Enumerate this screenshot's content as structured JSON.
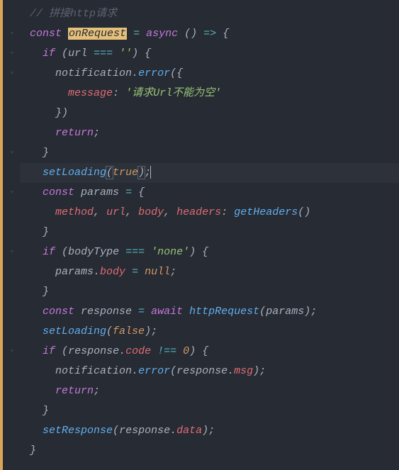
{
  "code": {
    "l1": {
      "comment": "// 拼接http请求"
    },
    "l2": {
      "kw1": "const",
      "name": "onRequest",
      "op": "=",
      "kw2": "async",
      "parens": "()",
      "arrow": "=>",
      "brace": "{"
    },
    "l3": {
      "kw": "if",
      "open": "(",
      "var": "url",
      "op": "===",
      "str": "''",
      "close": ")",
      "brace": "{"
    },
    "l4": {
      "obj": "notification",
      "dot": ".",
      "method": "error",
      "open": "(",
      "brace": "{"
    },
    "l5": {
      "prop": "message",
      "colon": ":",
      "str": "'请求Url不能为空'"
    },
    "l6": {
      "brace": "}",
      "close": ")"
    },
    "l7": {
      "kw": "return",
      "semi": ";"
    },
    "l8": {
      "brace": "}"
    },
    "l9": {
      "fn": "setLoading",
      "open": "(",
      "val": "true",
      "close": ")",
      "semi": ";"
    },
    "l10": {
      "kw": "const",
      "var": "params",
      "op": "=",
      "brace": "{"
    },
    "l11": {
      "p1": "method",
      "c1": ",",
      "p2": "url",
      "c2": ",",
      "p3": "body",
      "c3": ",",
      "p4": "headers",
      "colon": ":",
      "fn": "getHeaders",
      "parens": "()"
    },
    "l12": {
      "brace": "}"
    },
    "l13": {
      "kw": "if",
      "open": "(",
      "var": "bodyType",
      "op": "===",
      "str": "'none'",
      "close": ")",
      "brace": "{"
    },
    "l14": {
      "obj": "params",
      "dot": ".",
      "prop": "body",
      "op": "=",
      "val": "null",
      "semi": ";"
    },
    "l15": {
      "brace": "}"
    },
    "l16": {
      "kw1": "const",
      "var": "response",
      "op": "=",
      "kw2": "await",
      "fn": "httpRequest",
      "open": "(",
      "arg": "params",
      "close": ")",
      "semi": ";"
    },
    "l17": {
      "fn": "setLoading",
      "open": "(",
      "val": "false",
      "close": ")",
      "semi": ";"
    },
    "l18": {
      "kw": "if",
      "open": "(",
      "obj": "response",
      "dot": ".",
      "prop": "code",
      "op": "!==",
      "num": "0",
      "close": ")",
      "brace": "{"
    },
    "l19": {
      "obj": "notification",
      "dot1": ".",
      "method": "error",
      "open": "(",
      "obj2": "response",
      "dot2": ".",
      "prop": "msg",
      "close": ")",
      "semi": ";"
    },
    "l20": {
      "kw": "return",
      "semi": ";"
    },
    "l21": {
      "brace": "}"
    },
    "l22": {
      "fn": "setResponse",
      "open": "(",
      "obj": "response",
      "dot": ".",
      "prop": "data",
      "close": ")",
      "semi": ";"
    },
    "l23": {
      "brace": "}"
    }
  }
}
